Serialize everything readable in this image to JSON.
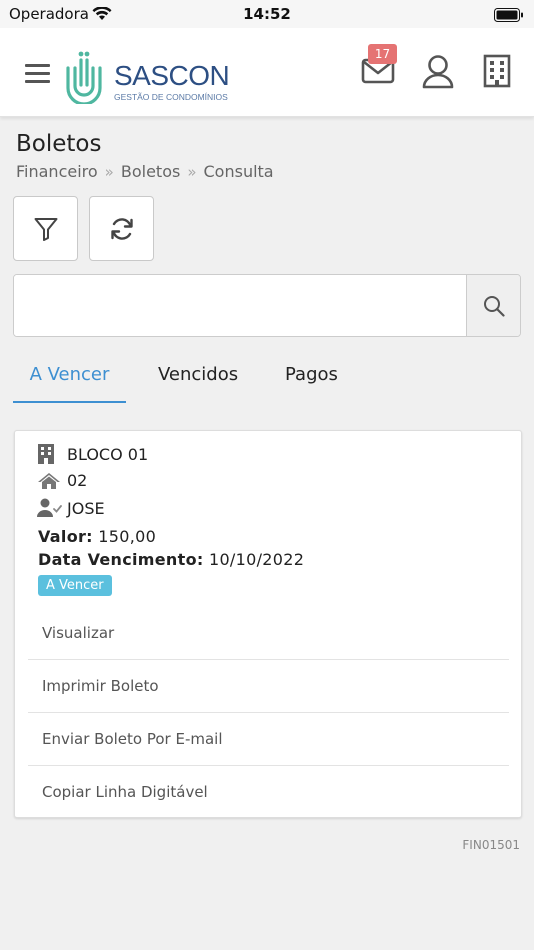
{
  "status_bar": {
    "carrier": "Operadora",
    "time": "14:52"
  },
  "header": {
    "logo_name": "SASCON",
    "logo_tagline": "GESTÃO DE CONDOMÍNIOS",
    "mail_badge": "17",
    "icons": [
      "menu-icon",
      "mail-icon",
      "user-icon",
      "building-icon"
    ]
  },
  "page": {
    "title": "Boletos",
    "breadcrumb": [
      "Financeiro",
      "Boletos",
      "Consulta"
    ]
  },
  "toolbar": {
    "icons": [
      "filter-icon",
      "refresh-icon"
    ]
  },
  "search": {
    "value": "",
    "placeholder": ""
  },
  "tabs": [
    {
      "label": "A Vencer",
      "active": true
    },
    {
      "label": "Vencidos",
      "active": false
    },
    {
      "label": "Pagos",
      "active": false
    }
  ],
  "boleto": {
    "bloco": "BLOCO 01",
    "unidade": "02",
    "morador": "JOSE",
    "valor_label": "Valor:",
    "valor": "150,00",
    "vencimento_label": "Data Vencimento:",
    "vencimento": "10/10/2022",
    "status": "A Vencer",
    "actions": [
      "Visualizar",
      "Imprimir Boleto",
      "Enviar Boleto Por E-mail",
      "Copiar Linha Digitável"
    ]
  },
  "footer": {
    "code": "FIN01501"
  },
  "colors": {
    "accent": "#3d8fd1",
    "badge": "#e57373",
    "status": "#5bc0de",
    "logo_blue": "#2d4f83",
    "logo_green": "#4fb7a0"
  }
}
